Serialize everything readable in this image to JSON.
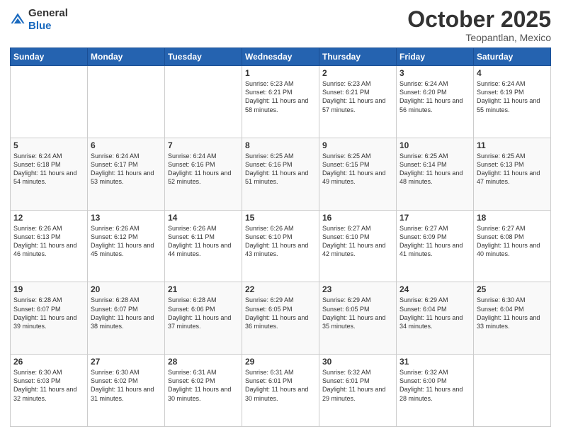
{
  "header": {
    "logo_general": "General",
    "logo_blue": "Blue",
    "month": "October 2025",
    "location": "Teopantlan, Mexico"
  },
  "weekdays": [
    "Sunday",
    "Monday",
    "Tuesday",
    "Wednesday",
    "Thursday",
    "Friday",
    "Saturday"
  ],
  "weeks": [
    [
      {
        "day": "",
        "sunrise": "",
        "sunset": "",
        "daylight": ""
      },
      {
        "day": "",
        "sunrise": "",
        "sunset": "",
        "daylight": ""
      },
      {
        "day": "",
        "sunrise": "",
        "sunset": "",
        "daylight": ""
      },
      {
        "day": "1",
        "sunrise": "Sunrise: 6:23 AM",
        "sunset": "Sunset: 6:21 PM",
        "daylight": "Daylight: 11 hours and 58 minutes."
      },
      {
        "day": "2",
        "sunrise": "Sunrise: 6:23 AM",
        "sunset": "Sunset: 6:21 PM",
        "daylight": "Daylight: 11 hours and 57 minutes."
      },
      {
        "day": "3",
        "sunrise": "Sunrise: 6:24 AM",
        "sunset": "Sunset: 6:20 PM",
        "daylight": "Daylight: 11 hours and 56 minutes."
      },
      {
        "day": "4",
        "sunrise": "Sunrise: 6:24 AM",
        "sunset": "Sunset: 6:19 PM",
        "daylight": "Daylight: 11 hours and 55 minutes."
      }
    ],
    [
      {
        "day": "5",
        "sunrise": "Sunrise: 6:24 AM",
        "sunset": "Sunset: 6:18 PM",
        "daylight": "Daylight: 11 hours and 54 minutes."
      },
      {
        "day": "6",
        "sunrise": "Sunrise: 6:24 AM",
        "sunset": "Sunset: 6:17 PM",
        "daylight": "Daylight: 11 hours and 53 minutes."
      },
      {
        "day": "7",
        "sunrise": "Sunrise: 6:24 AM",
        "sunset": "Sunset: 6:16 PM",
        "daylight": "Daylight: 11 hours and 52 minutes."
      },
      {
        "day": "8",
        "sunrise": "Sunrise: 6:25 AM",
        "sunset": "Sunset: 6:16 PM",
        "daylight": "Daylight: 11 hours and 51 minutes."
      },
      {
        "day": "9",
        "sunrise": "Sunrise: 6:25 AM",
        "sunset": "Sunset: 6:15 PM",
        "daylight": "Daylight: 11 hours and 49 minutes."
      },
      {
        "day": "10",
        "sunrise": "Sunrise: 6:25 AM",
        "sunset": "Sunset: 6:14 PM",
        "daylight": "Daylight: 11 hours and 48 minutes."
      },
      {
        "day": "11",
        "sunrise": "Sunrise: 6:25 AM",
        "sunset": "Sunset: 6:13 PM",
        "daylight": "Daylight: 11 hours and 47 minutes."
      }
    ],
    [
      {
        "day": "12",
        "sunrise": "Sunrise: 6:26 AM",
        "sunset": "Sunset: 6:13 PM",
        "daylight": "Daylight: 11 hours and 46 minutes."
      },
      {
        "day": "13",
        "sunrise": "Sunrise: 6:26 AM",
        "sunset": "Sunset: 6:12 PM",
        "daylight": "Daylight: 11 hours and 45 minutes."
      },
      {
        "day": "14",
        "sunrise": "Sunrise: 6:26 AM",
        "sunset": "Sunset: 6:11 PM",
        "daylight": "Daylight: 11 hours and 44 minutes."
      },
      {
        "day": "15",
        "sunrise": "Sunrise: 6:26 AM",
        "sunset": "Sunset: 6:10 PM",
        "daylight": "Daylight: 11 hours and 43 minutes."
      },
      {
        "day": "16",
        "sunrise": "Sunrise: 6:27 AM",
        "sunset": "Sunset: 6:10 PM",
        "daylight": "Daylight: 11 hours and 42 minutes."
      },
      {
        "day": "17",
        "sunrise": "Sunrise: 6:27 AM",
        "sunset": "Sunset: 6:09 PM",
        "daylight": "Daylight: 11 hours and 41 minutes."
      },
      {
        "day": "18",
        "sunrise": "Sunrise: 6:27 AM",
        "sunset": "Sunset: 6:08 PM",
        "daylight": "Daylight: 11 hours and 40 minutes."
      }
    ],
    [
      {
        "day": "19",
        "sunrise": "Sunrise: 6:28 AM",
        "sunset": "Sunset: 6:07 PM",
        "daylight": "Daylight: 11 hours and 39 minutes."
      },
      {
        "day": "20",
        "sunrise": "Sunrise: 6:28 AM",
        "sunset": "Sunset: 6:07 PM",
        "daylight": "Daylight: 11 hours and 38 minutes."
      },
      {
        "day": "21",
        "sunrise": "Sunrise: 6:28 AM",
        "sunset": "Sunset: 6:06 PM",
        "daylight": "Daylight: 11 hours and 37 minutes."
      },
      {
        "day": "22",
        "sunrise": "Sunrise: 6:29 AM",
        "sunset": "Sunset: 6:05 PM",
        "daylight": "Daylight: 11 hours and 36 minutes."
      },
      {
        "day": "23",
        "sunrise": "Sunrise: 6:29 AM",
        "sunset": "Sunset: 6:05 PM",
        "daylight": "Daylight: 11 hours and 35 minutes."
      },
      {
        "day": "24",
        "sunrise": "Sunrise: 6:29 AM",
        "sunset": "Sunset: 6:04 PM",
        "daylight": "Daylight: 11 hours and 34 minutes."
      },
      {
        "day": "25",
        "sunrise": "Sunrise: 6:30 AM",
        "sunset": "Sunset: 6:04 PM",
        "daylight": "Daylight: 11 hours and 33 minutes."
      }
    ],
    [
      {
        "day": "26",
        "sunrise": "Sunrise: 6:30 AM",
        "sunset": "Sunset: 6:03 PM",
        "daylight": "Daylight: 11 hours and 32 minutes."
      },
      {
        "day": "27",
        "sunrise": "Sunrise: 6:30 AM",
        "sunset": "Sunset: 6:02 PM",
        "daylight": "Daylight: 11 hours and 31 minutes."
      },
      {
        "day": "28",
        "sunrise": "Sunrise: 6:31 AM",
        "sunset": "Sunset: 6:02 PM",
        "daylight": "Daylight: 11 hours and 30 minutes."
      },
      {
        "day": "29",
        "sunrise": "Sunrise: 6:31 AM",
        "sunset": "Sunset: 6:01 PM",
        "daylight": "Daylight: 11 hours and 30 minutes."
      },
      {
        "day": "30",
        "sunrise": "Sunrise: 6:32 AM",
        "sunset": "Sunset: 6:01 PM",
        "daylight": "Daylight: 11 hours and 29 minutes."
      },
      {
        "day": "31",
        "sunrise": "Sunrise: 6:32 AM",
        "sunset": "Sunset: 6:00 PM",
        "daylight": "Daylight: 11 hours and 28 minutes."
      },
      {
        "day": "",
        "sunrise": "",
        "sunset": "",
        "daylight": ""
      }
    ]
  ]
}
